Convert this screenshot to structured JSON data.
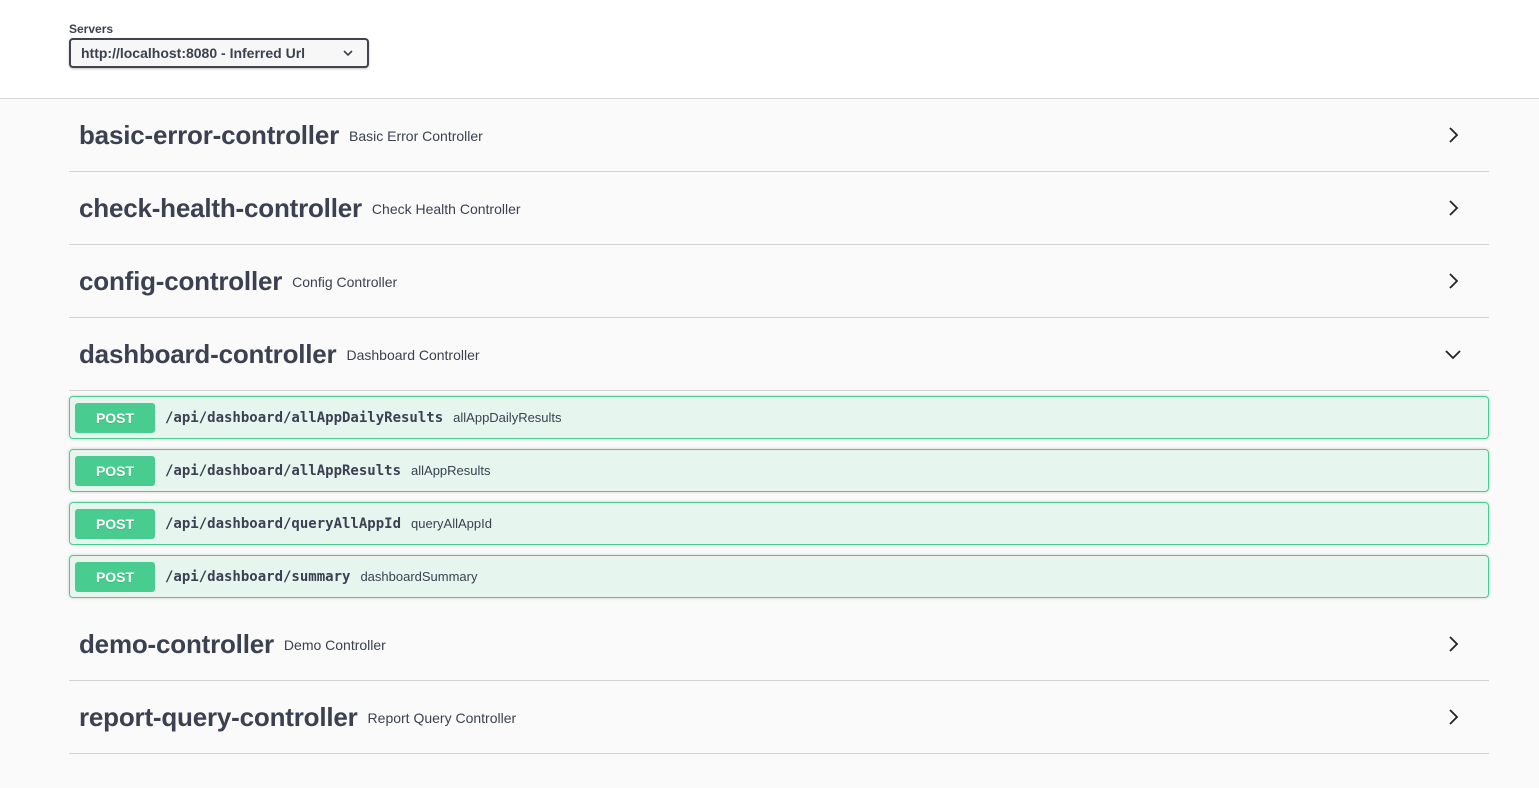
{
  "servers": {
    "label": "Servers",
    "selected": "http://localhost:8080 - Inferred Url"
  },
  "tags_before": [
    {
      "name": "basic-error-controller",
      "description": "Basic Error Controller",
      "expanded": false
    },
    {
      "name": "check-health-controller",
      "description": "Check Health Controller",
      "expanded": false
    },
    {
      "name": "config-controller",
      "description": "Config Controller",
      "expanded": false
    }
  ],
  "expanded_tag": {
    "name": "dashboard-controller",
    "description": "Dashboard Controller",
    "expanded": true
  },
  "operations": [
    {
      "method": "POST",
      "path": "/api/dashboard/allAppDailyResults",
      "summary": "allAppDailyResults"
    },
    {
      "method": "POST",
      "path": "/api/dashboard/allAppResults",
      "summary": "allAppResults"
    },
    {
      "method": "POST",
      "path": "/api/dashboard/queryAllAppId",
      "summary": "queryAllAppId"
    },
    {
      "method": "POST",
      "path": "/api/dashboard/summary",
      "summary": "dashboardSummary"
    }
  ],
  "tags_after": [
    {
      "name": "demo-controller",
      "description": "Demo Controller",
      "expanded": false
    },
    {
      "name": "report-query-controller",
      "description": "Report Query Controller",
      "expanded": false
    }
  ],
  "colors": {
    "post": "#49cc90",
    "text": "#3b4151"
  },
  "icons": {
    "collapsed": "chevron-right-icon",
    "expanded": "chevron-down-icon",
    "select": "chevron-down-icon"
  }
}
